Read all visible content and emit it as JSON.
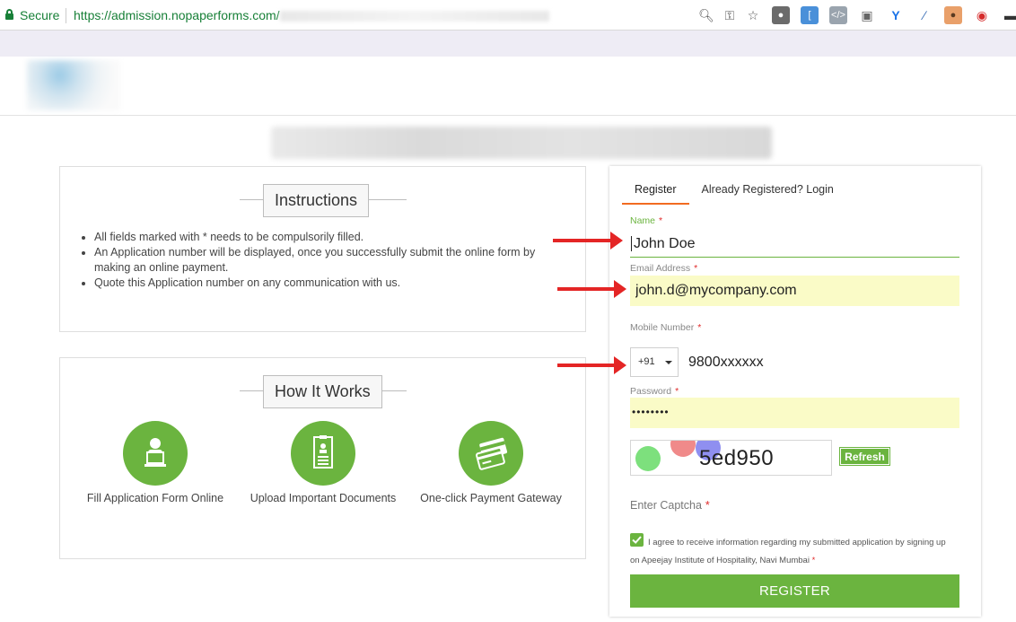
{
  "browser": {
    "secure_label": "Secure",
    "url": "https://admission.nopaperforms.com/"
  },
  "instructions": {
    "title": "Instructions",
    "items": [
      "All fields marked with * needs to be compulsorily filled.",
      "An Application number will be displayed, once you successfully submit the online form by making an online payment.",
      "Quote this Application number on any communication with us."
    ]
  },
  "how_it_works": {
    "title": "How It Works",
    "items": [
      {
        "label": "Fill Application Form Online",
        "icon": "person-laptop-icon"
      },
      {
        "label": "Upload Important Documents",
        "icon": "document-icon"
      },
      {
        "label": "One-click Payment Gateway",
        "icon": "credit-card-icon"
      }
    ]
  },
  "form": {
    "tabs": [
      "Register",
      "Already Registered? Login"
    ],
    "name_label": "Name",
    "name_value": "John Doe",
    "email_label": "Email Address",
    "email_value": "john.d@mycompany.com",
    "mobile_label": "Mobile Number",
    "country_code": "+91",
    "mobile_value": "9800xxxxxx",
    "password_label": "Password",
    "password_value": "••••••••",
    "captcha_value": "5ed950",
    "refresh_label": "Refresh",
    "captcha_label": "Enter Captcha",
    "required_mark": "*",
    "agree_text": "I agree to receive information regarding my submitted application by signing up on Apeejay Institute of Hospitality, Navi Mumbai",
    "agree_checked": true,
    "register_label": "REGISTER"
  },
  "colors": {
    "accent_green": "#6bb43f",
    "tab_underline": "#f26b21",
    "autofill_yellow": "#fafbc7",
    "annotation_red": "#e42525"
  }
}
